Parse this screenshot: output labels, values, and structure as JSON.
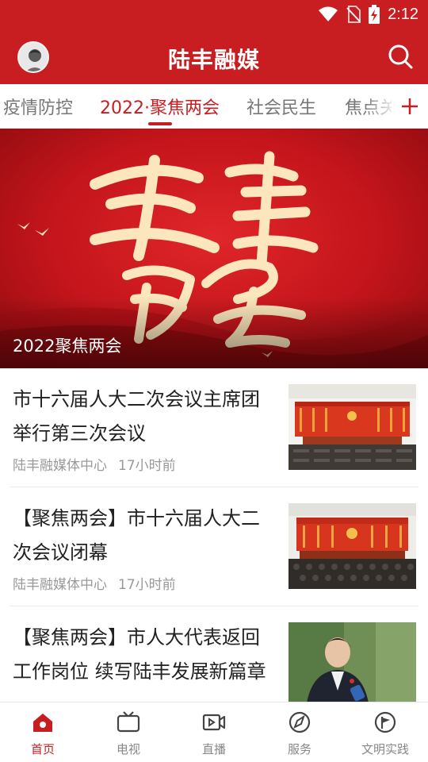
{
  "status_bar": {
    "time": "2:12",
    "icons": [
      "wifi-icon",
      "no-sim-icon",
      "battery-charging-icon"
    ]
  },
  "app_bar": {
    "title": "陆丰融媒",
    "avatar": "avatar",
    "search_icon": "search-icon"
  },
  "tabs": {
    "items": [
      {
        "label": "疫情防控",
        "active": false
      },
      {
        "label": "2022·聚焦两会",
        "active": true
      },
      {
        "label": "社会民生",
        "active": false
      },
      {
        "label": "焦点关注",
        "active": false
      }
    ],
    "add_icon": "plus-icon"
  },
  "banner": {
    "artwork_text": "聚焦两会",
    "caption": "2022聚焦两会"
  },
  "news": [
    {
      "title": "市十六届人大二次会议主席团举行第三次会议",
      "source": "陆丰融媒体中心",
      "time": "17小时前",
      "thumb": "meeting-hall-photo"
    },
    {
      "title": "【聚焦两会】市十六届人大二次会议闭幕",
      "source": "陆丰融媒体中心",
      "time": "17小时前",
      "thumb": "assembly-closing-photo"
    },
    {
      "title": "【聚焦两会】市人大代表返回工作岗位 续写陆丰发展新篇章",
      "source": "",
      "time": "",
      "thumb": "delegate-interview-photo"
    }
  ],
  "bottom_nav": [
    {
      "label": "首页",
      "icon": "home-icon",
      "active": true
    },
    {
      "label": "电视",
      "icon": "tv-icon",
      "active": false
    },
    {
      "label": "直播",
      "icon": "live-video-icon",
      "active": false
    },
    {
      "label": "服务",
      "icon": "compass-icon",
      "active": false
    },
    {
      "label": "文明实践",
      "icon": "flag-icon",
      "active": false
    }
  ],
  "colors": {
    "brand_red": "#c81e22",
    "inactive_text": "#777777",
    "meta_text": "#999999"
  }
}
